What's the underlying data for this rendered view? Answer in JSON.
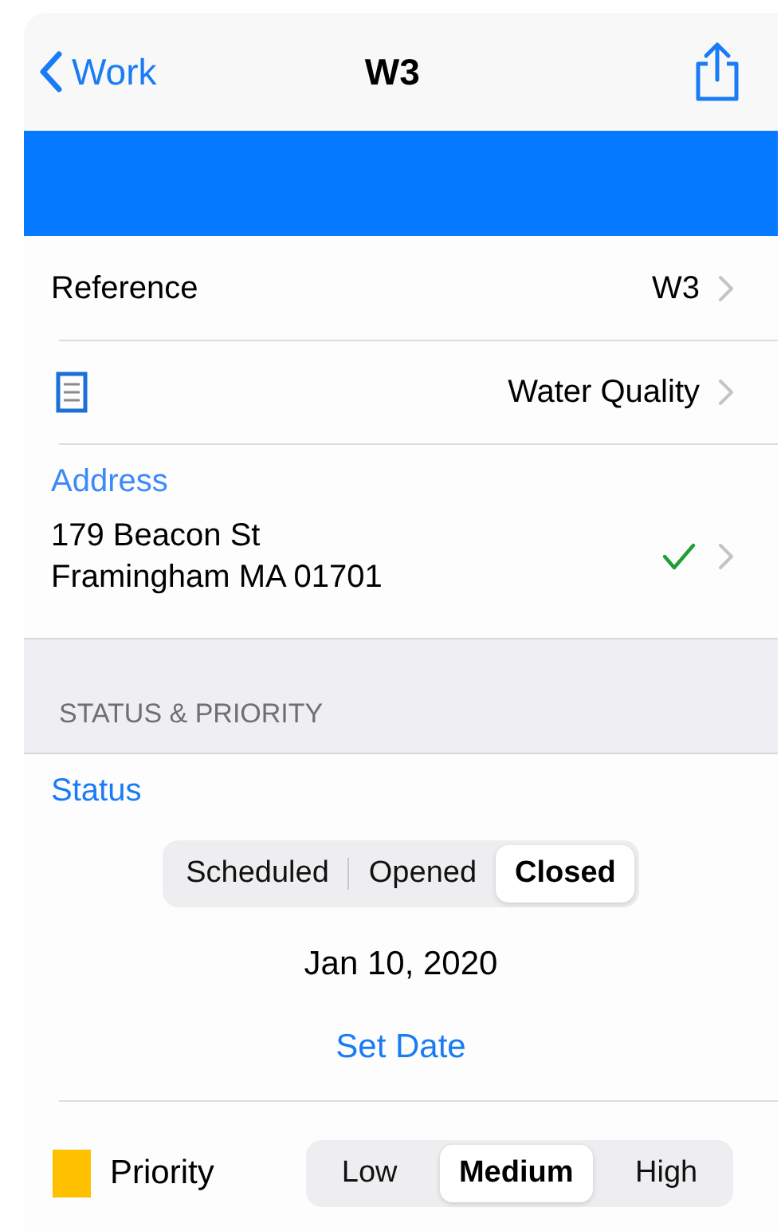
{
  "nav": {
    "back": "Work",
    "title": "W3"
  },
  "reference": {
    "label": "Reference",
    "value": "W3"
  },
  "form": {
    "value": "Water Quality"
  },
  "address": {
    "label": "Address",
    "lines": [
      "179 Beacon St",
      "Framingham MA 01701"
    ],
    "verified": true
  },
  "section": {
    "header": "STATUS & PRIORITY"
  },
  "status": {
    "label": "Status",
    "options": [
      {
        "label": "Scheduled",
        "selected": false
      },
      {
        "label": "Opened",
        "selected": false
      },
      {
        "label": "Closed",
        "selected": true
      }
    ],
    "date": "Jan 10, 2020",
    "action": "Set Date"
  },
  "priority": {
    "label": "Priority",
    "color": "#ffc000",
    "options": [
      {
        "label": "Low",
        "selected": false
      },
      {
        "label": "Medium",
        "selected": true
      },
      {
        "label": "High",
        "selected": false
      }
    ]
  }
}
